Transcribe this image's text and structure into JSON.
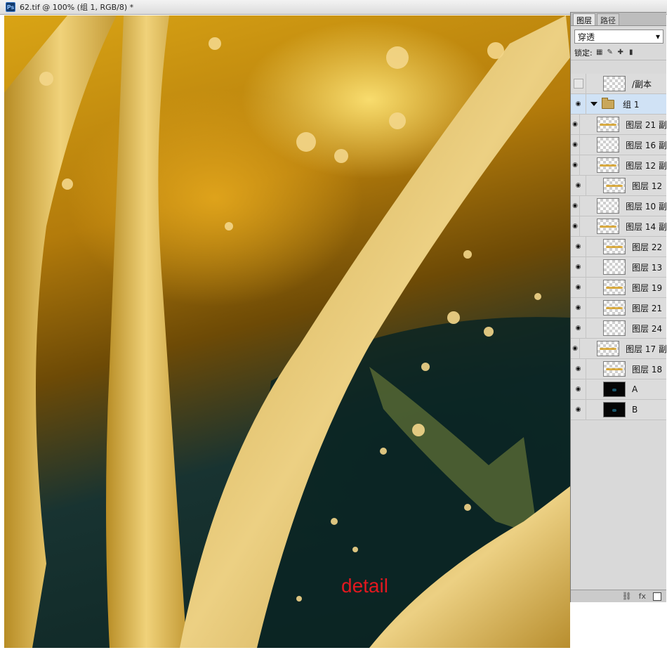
{
  "window": {
    "app_badge": "Ps",
    "title": "62.tif @ 100% (组 1, RGB/8) *"
  },
  "canvas": {
    "watermark": "detail",
    "watermark_color": "#e2181f"
  },
  "panel": {
    "tabs": [
      {
        "label": "图层",
        "active": true
      },
      {
        "label": "路径",
        "active": false
      }
    ],
    "blend_mode": "穿透",
    "lock_label": "锁定:",
    "layers": [
      {
        "name": "/副本",
        "visible": false,
        "type": "layer"
      },
      {
        "name": "组 1",
        "visible": true,
        "type": "group",
        "selected": true
      },
      {
        "name": "图层 21 副",
        "visible": true,
        "type": "layer"
      },
      {
        "name": "图层 16 副",
        "visible": true,
        "type": "layer"
      },
      {
        "name": "图层 12 副",
        "visible": true,
        "type": "layer"
      },
      {
        "name": "图层 12",
        "visible": true,
        "type": "layer"
      },
      {
        "name": "图层 10 副",
        "visible": true,
        "type": "layer"
      },
      {
        "name": "图层 14 副",
        "visible": true,
        "type": "layer"
      },
      {
        "name": "图层 22",
        "visible": true,
        "type": "layer"
      },
      {
        "name": "图层 13",
        "visible": true,
        "type": "layer"
      },
      {
        "name": "图层 19",
        "visible": true,
        "type": "layer"
      },
      {
        "name": "图层 21",
        "visible": true,
        "type": "layer"
      },
      {
        "name": "图层 24",
        "visible": true,
        "type": "layer"
      },
      {
        "name": "图层 17 副",
        "visible": true,
        "type": "layer"
      },
      {
        "name": "图层 18",
        "visible": true,
        "type": "layer"
      },
      {
        "name": "A",
        "visible": true,
        "type": "dark"
      },
      {
        "name": "B",
        "visible": true,
        "type": "dark"
      }
    ],
    "footer_icons": [
      "link-icon",
      "fx-icon",
      "mask-icon"
    ],
    "footer_fx": "fx"
  }
}
